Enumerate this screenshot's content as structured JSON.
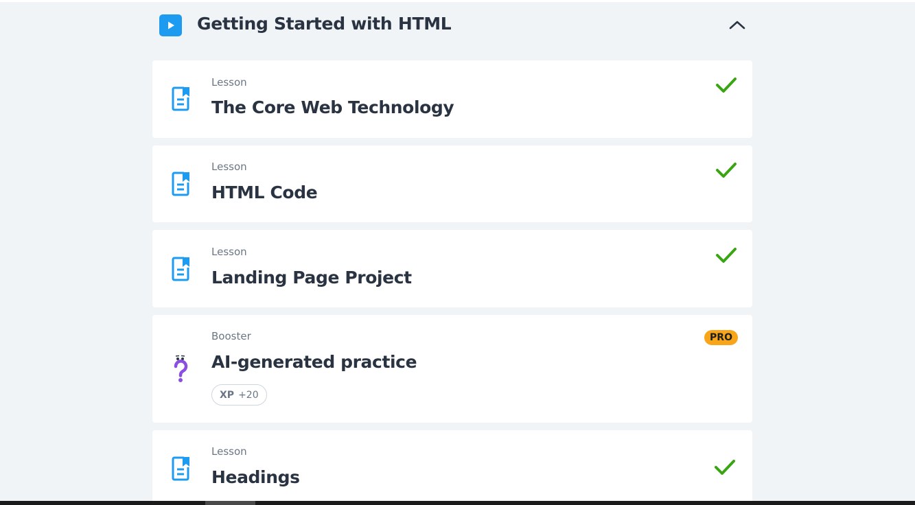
{
  "module": {
    "title": "Getting Started with HTML",
    "icon": "play-icon",
    "collapse_icon": "chevron-up-icon",
    "accent_color": "#1d9bf0"
  },
  "items": [
    {
      "kind": "Lesson",
      "title": "The Core Web Technology",
      "status": "completed",
      "icon": "lesson-document-icon"
    },
    {
      "kind": "Lesson",
      "title": "HTML Code",
      "status": "completed",
      "icon": "lesson-document-icon"
    },
    {
      "kind": "Lesson",
      "title": "Landing Page Project",
      "status": "completed",
      "icon": "lesson-document-icon"
    },
    {
      "kind": "Booster",
      "title": "AI-generated practice",
      "badge": "PRO",
      "xp_label": "XP",
      "xp_value": "+20",
      "icon": "question-mark-icon"
    },
    {
      "kind": "Lesson",
      "title": "Headings",
      "status": "completed",
      "icon": "lesson-document-icon"
    }
  ],
  "colors": {
    "check": "#3aa512",
    "pro_badge": "#f9a51a",
    "booster_icon": "#8a4fe0"
  }
}
